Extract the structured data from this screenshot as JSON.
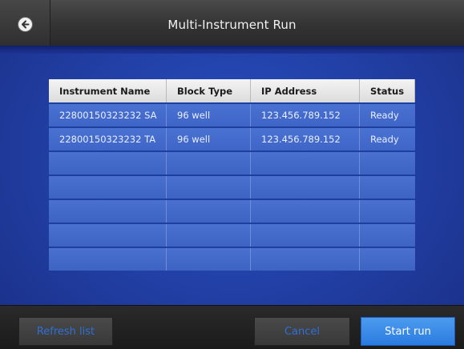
{
  "header": {
    "title": "Multi-Instrument Run",
    "back_icon": "back-arrow-icon"
  },
  "table": {
    "columns": [
      "Instrument Name",
      "Block Type",
      "IP Address",
      "Status"
    ],
    "rows": [
      [
        "22800150323232 SA",
        "96 well",
        "123.456.789.152",
        "Ready"
      ],
      [
        "22800150323232 TA",
        "96 well",
        "123.456.789.152",
        "Ready"
      ],
      [
        "",
        "",
        "",
        ""
      ],
      [
        "",
        "",
        "",
        ""
      ],
      [
        "",
        "",
        "",
        ""
      ],
      [
        "",
        "",
        "",
        ""
      ],
      [
        "",
        "",
        "",
        ""
      ]
    ]
  },
  "footer": {
    "refresh_label": "Refresh list",
    "cancel_label": "Cancel",
    "start_label": "Start run"
  },
  "colors": {
    "accent": "#2a7be0",
    "secondary_button_text": "#2f6fd6",
    "background": "#2241a8"
  }
}
